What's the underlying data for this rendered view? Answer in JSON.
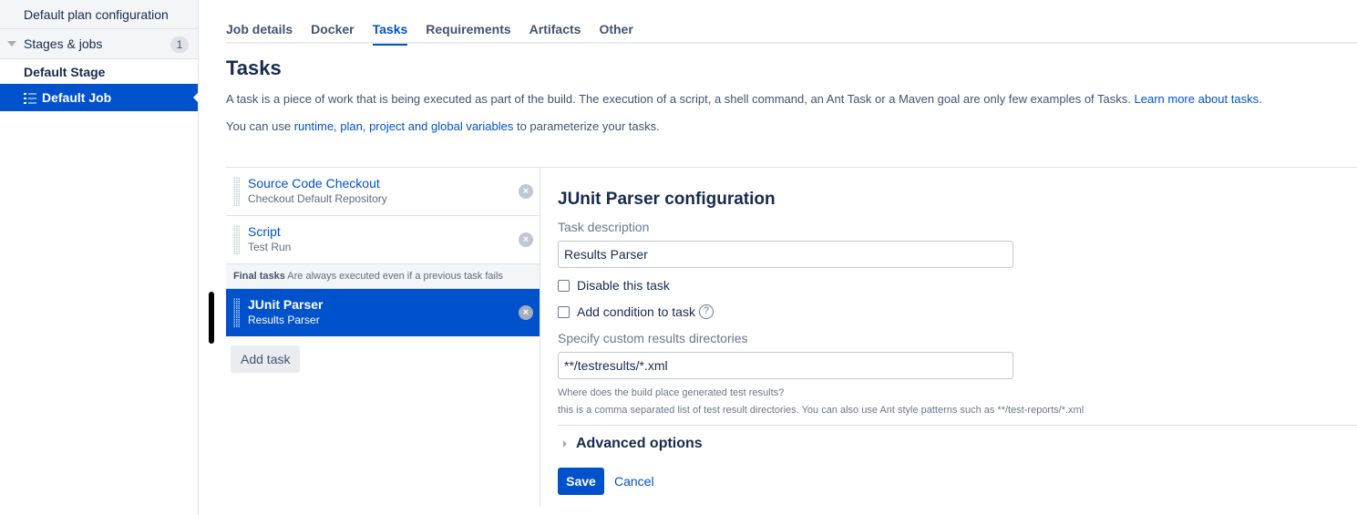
{
  "sidebar": {
    "plan_config": "Default plan configuration",
    "stages_label": "Stages & jobs",
    "stages_count": "1",
    "stage_name": "Default Stage",
    "job_name": "Default Job"
  },
  "tabs": [
    {
      "label": "Job details"
    },
    {
      "label": "Docker"
    },
    {
      "label": "Tasks",
      "active": true
    },
    {
      "label": "Requirements"
    },
    {
      "label": "Artifacts"
    },
    {
      "label": "Other"
    }
  ],
  "page": {
    "title": "Tasks",
    "desc1_text": "A task is a piece of work that is being executed as part of the build. The execution of a script, a shell command, an Ant Task or a Maven goal are only few examples of Tasks. ",
    "desc1_link": "Learn more about tasks.",
    "desc2_prefix": "You can use ",
    "desc2_link": "runtime, plan, project and global variables",
    "desc2_suffix": " to parameterize your tasks."
  },
  "tasks": [
    {
      "name": "Source Code Checkout",
      "description": "Checkout Default Repository"
    },
    {
      "name": "Script",
      "description": "Test Run"
    }
  ],
  "final_tasks": {
    "header_bold": "Final tasks",
    "header_text": " Are always executed even if a previous task fails",
    "items": [
      {
        "name": "JUnit Parser",
        "description": "Results Parser",
        "selected": true
      }
    ]
  },
  "add_task_label": "Add task",
  "remove_icon_glyph": "×",
  "config": {
    "title": "JUnit Parser configuration",
    "task_description_label": "Task description",
    "task_description_value": "Results Parser",
    "disable_label": "Disable this task",
    "disable_checked": false,
    "condition_label": "Add condition to task",
    "condition_checked": false,
    "help_glyph": "?",
    "results_dirs_label": "Specify custom results directories",
    "results_dirs_value": "**/testresults/*.xml",
    "help_line1": "Where does the build place generated test results?",
    "help_line2": "this is a comma separated list of test result directories. You can also use Ant style patterns such as **/test-reports/*.xml",
    "advanced_label": "Advanced options",
    "save_label": "Save",
    "cancel_label": "Cancel"
  },
  "colors": {
    "accent": "#0052cc",
    "text": "#172b4d",
    "muted": "#6b778c"
  }
}
